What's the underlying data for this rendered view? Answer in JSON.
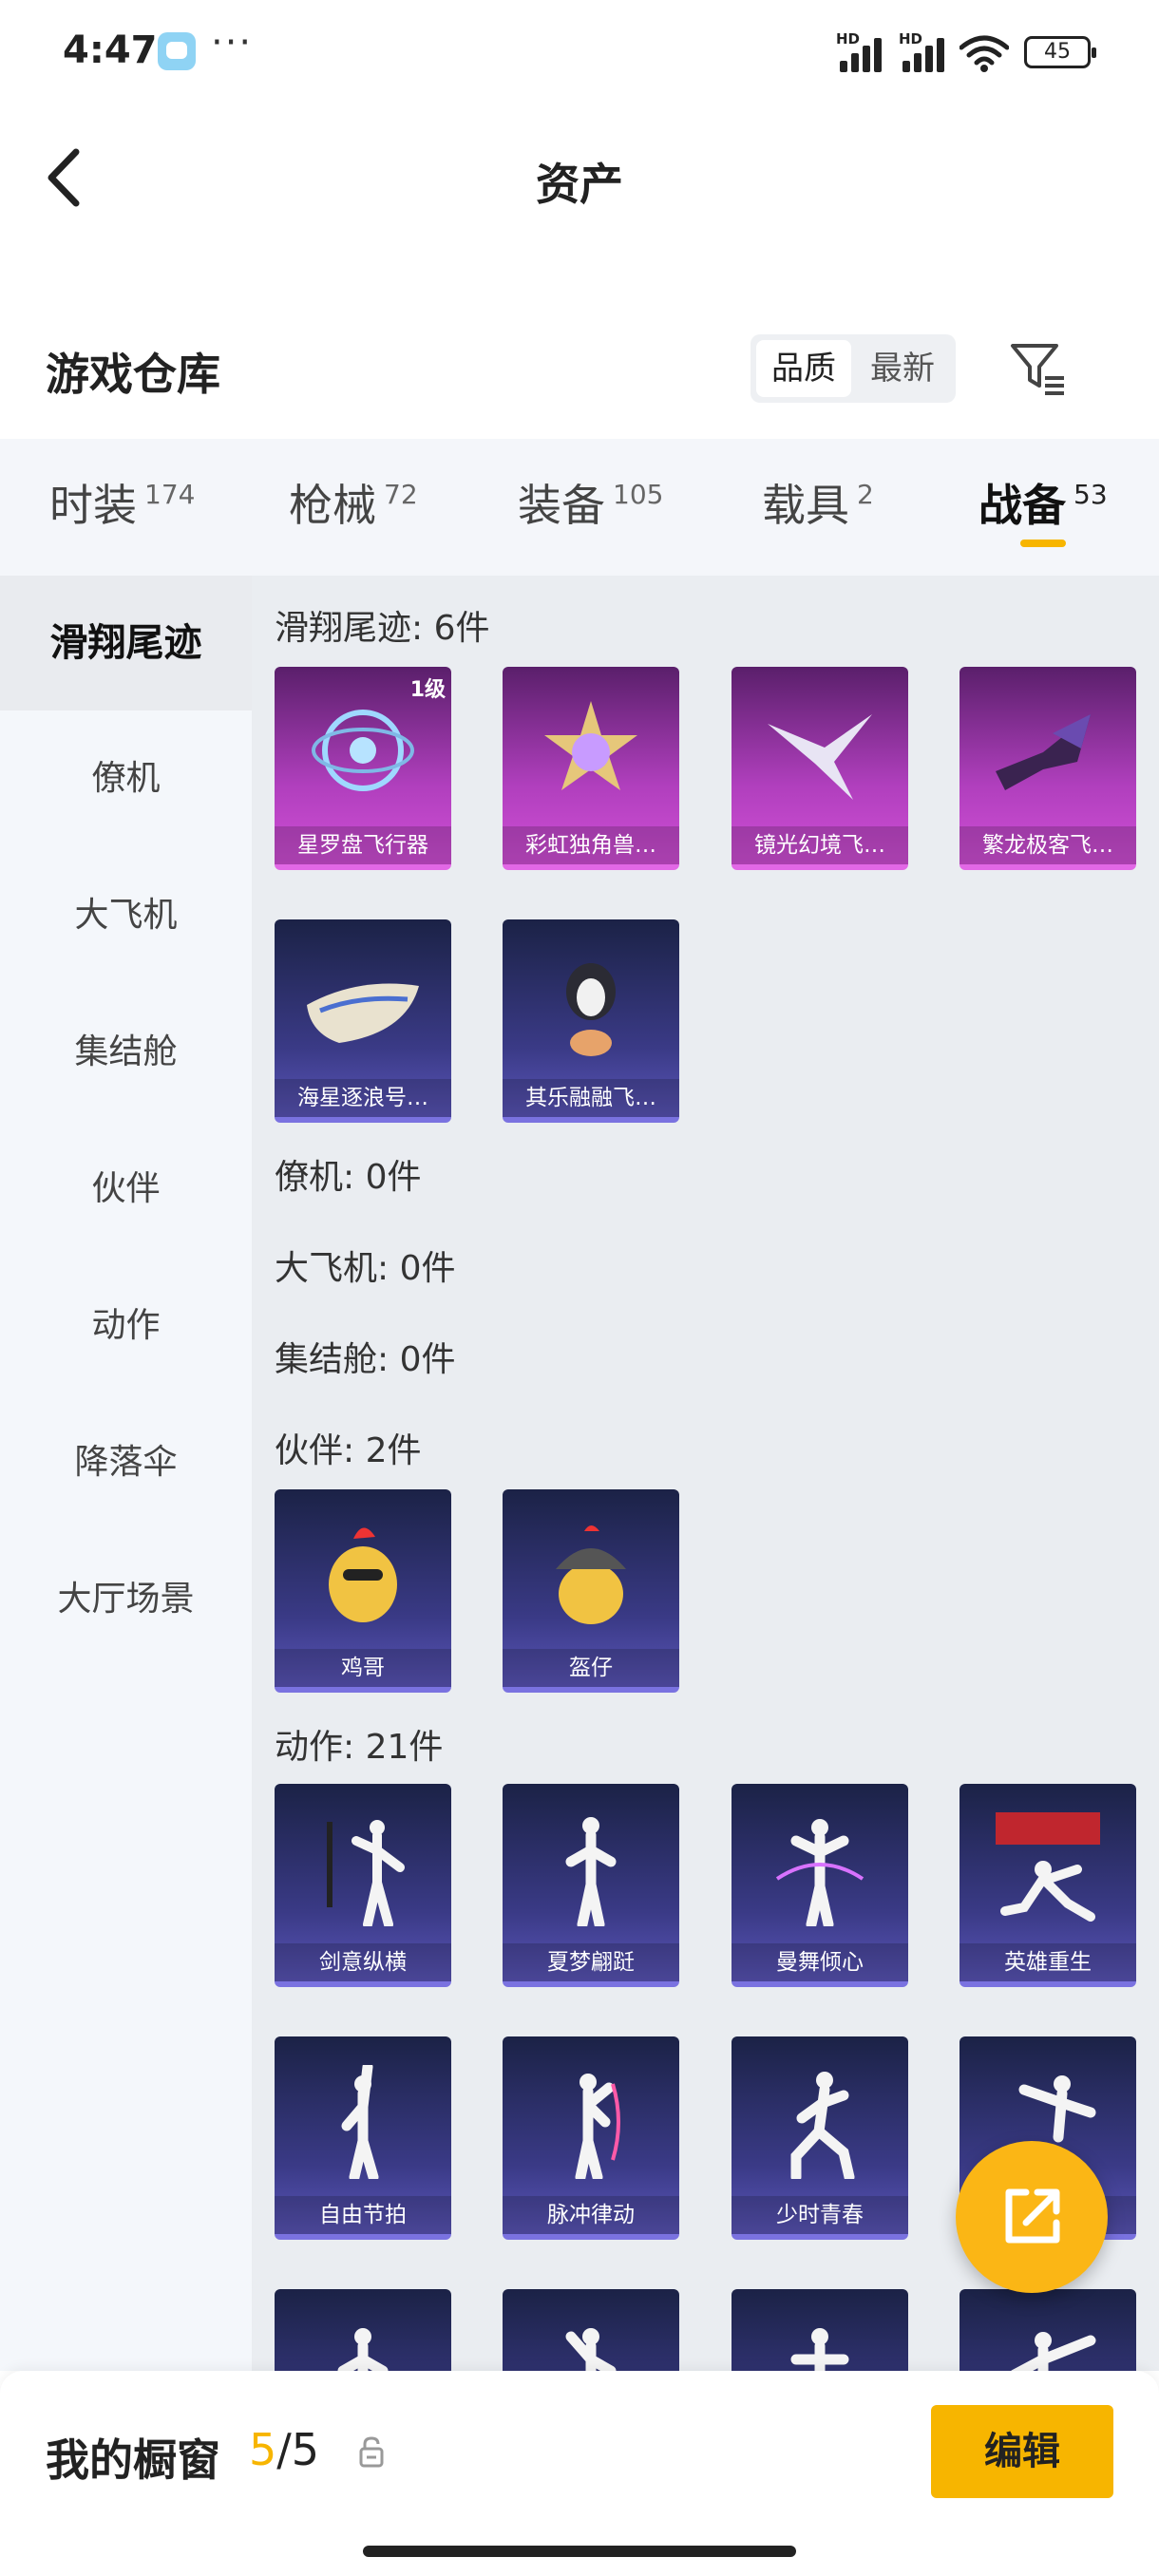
{
  "status": {
    "time": "4:47",
    "dots": "···",
    "battery": "45",
    "hd1": "HD",
    "hd2": "HD"
  },
  "nav": {
    "title": "资产"
  },
  "warehouse": {
    "title": "游戏仓库",
    "sort_options": [
      "品质",
      "最新"
    ]
  },
  "tabs": [
    {
      "label": "时装",
      "count": "174"
    },
    {
      "label": "枪械",
      "count": "72"
    },
    {
      "label": "装备",
      "count": "105"
    },
    {
      "label": "载具",
      "count": "2"
    },
    {
      "label": "战备",
      "count": "53"
    }
  ],
  "sidebar": [
    "滑翔尾迹",
    "僚机",
    "大飞机",
    "集结舱",
    "伙伴",
    "动作",
    "降落伞",
    "大厅场景"
  ],
  "sections": {
    "glide": "滑翔尾迹: 6件",
    "wingman": "僚机: 0件",
    "plane": "大飞机: 0件",
    "capsule": "集结舱: 0件",
    "partner": "伙伴: 2件",
    "emote": "动作: 21件"
  },
  "glide_items": [
    "星罗盘飞行器",
    "彩虹独角兽…",
    "镜光幻境飞…",
    "繁龙极客飞…",
    "海星逐浪号…",
    "其乐融融飞…"
  ],
  "glide_level": "1级",
  "partner_items": [
    "鸡哥",
    "盔仔"
  ],
  "emote_items": [
    "剑意纵横",
    "夏梦翩跹",
    "曼舞倾心",
    "英雄重生",
    "自由节拍",
    "脉冲律动",
    "少时青春",
    ""
  ],
  "showcase": {
    "title": "我的橱窗",
    "current": "5",
    "sep": "/",
    "total": "5",
    "edit_label": "编辑"
  }
}
